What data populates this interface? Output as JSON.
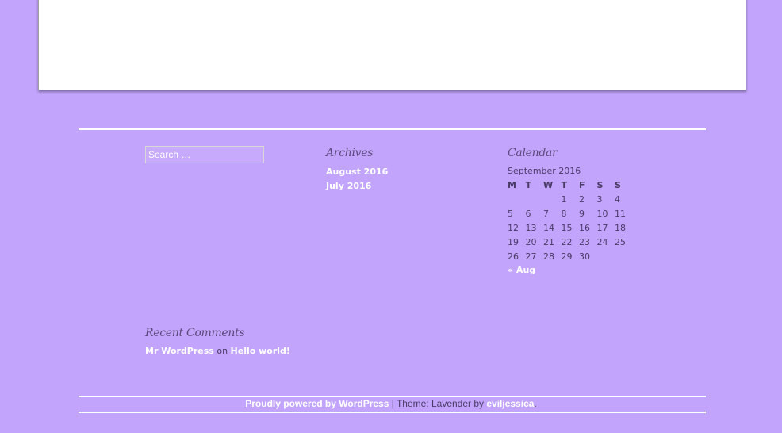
{
  "search": {
    "placeholder": "Search …"
  },
  "archives": {
    "title": "Archives",
    "items": [
      "August 2016",
      "July 2016"
    ]
  },
  "calendar": {
    "title": "Calendar",
    "caption": "September 2016",
    "days": [
      "M",
      "T",
      "W",
      "T",
      "F",
      "S",
      "S"
    ],
    "weeks": [
      [
        "",
        "",
        "",
        "1",
        "2",
        "3",
        "4"
      ],
      [
        "5",
        "6",
        "7",
        "8",
        "9",
        "10",
        "11"
      ],
      [
        "12",
        "13",
        "14",
        "15",
        "16",
        "17",
        "18"
      ],
      [
        "19",
        "20",
        "21",
        "22",
        "23",
        "24",
        "25"
      ],
      [
        "26",
        "27",
        "28",
        "29",
        "30",
        "",
        ""
      ]
    ],
    "prev_link": "« Aug"
  },
  "recent_comments": {
    "title": "Recent Comments",
    "author": "Mr WordPress",
    "on": "on",
    "post": "Hello world!"
  },
  "footer": {
    "powered": "Proudly powered by WordPress",
    "separator": " | Theme: Lavender by ",
    "author": "eviljessica",
    "end": "."
  },
  "colors": {
    "background": "#c3a4fd",
    "link": "#ffffff",
    "text": "#4a3b66"
  }
}
